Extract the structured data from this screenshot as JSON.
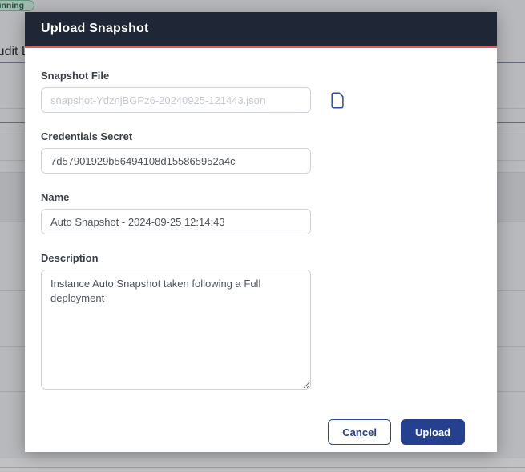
{
  "background": {
    "status_badge_label": "running",
    "page_title": "Audit Log"
  },
  "modal": {
    "title": "Upload Snapshot",
    "snapshot_file": {
      "label": "Snapshot File",
      "placeholder": "snapshot-YdznjBGPz6-20240925-121443.json"
    },
    "credentials_secret": {
      "label": "Credentials Secret",
      "value": "7d57901929b56494108d155865952a4c"
    },
    "name": {
      "label": "Name",
      "value": "Auto Snapshot - 2024-09-25 12:14:43"
    },
    "description": {
      "label": "Description",
      "value": "Instance Auto Snapshot taken following a Full deployment"
    },
    "footer": {
      "cancel_label": "Cancel",
      "upload_label": "Upload"
    }
  },
  "colors": {
    "header_bg": "#1f2636",
    "header_accent_line": "#e4575c",
    "primary_button": "#24408e",
    "badge_bg": "#d8f4e6",
    "badge_border": "#7cc5a0",
    "badge_text": "#276b52",
    "file_icon_blue": "#2c4aa2"
  }
}
